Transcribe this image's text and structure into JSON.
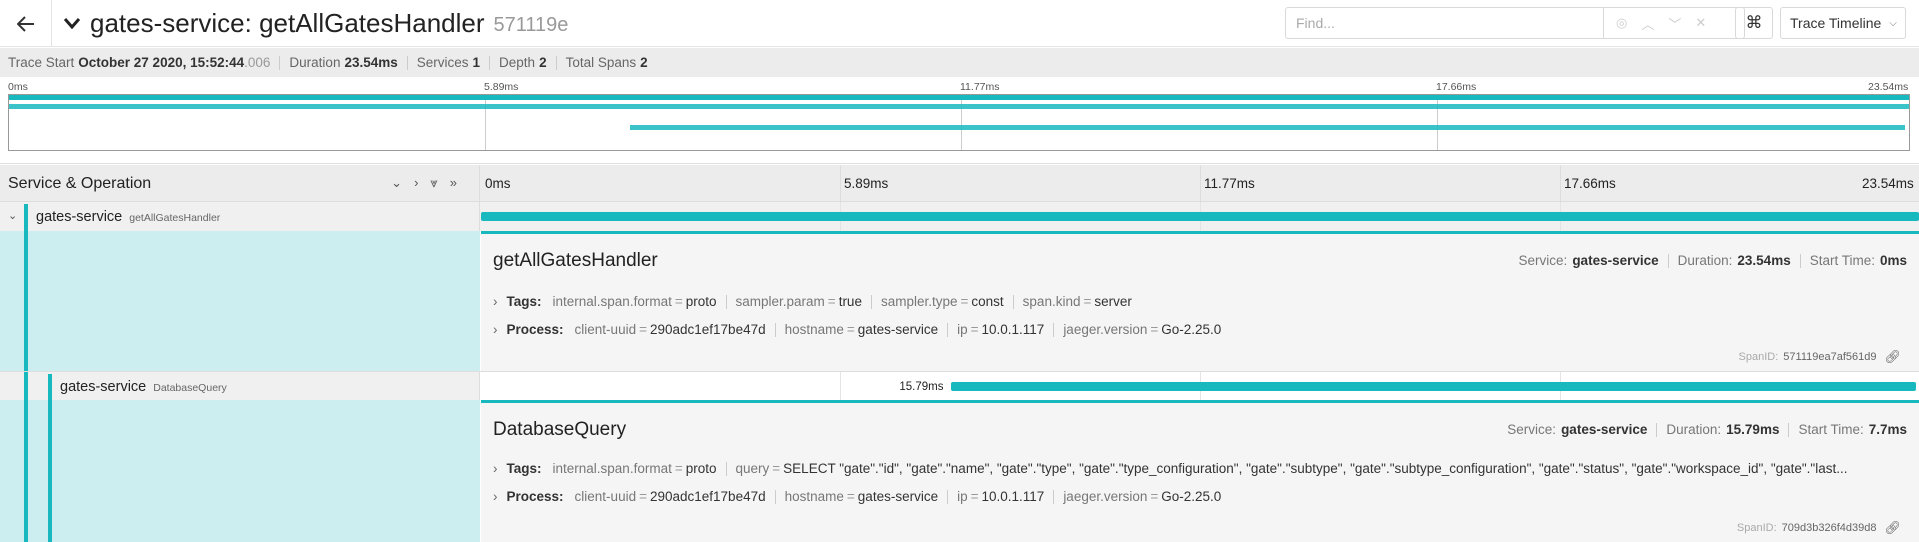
{
  "header": {
    "back_icon": "arrow-left-icon",
    "collapse_icon": "chevron-down-icon",
    "title": "gates-service: getAllGatesHandler",
    "trace_id": "571119e",
    "find_placeholder": "Find...",
    "keyboard_shortcut_label": "⌘",
    "view_mode": "Trace Timeline"
  },
  "summary": {
    "trace_start_label": "Trace Start",
    "trace_start_value": "October 27 2020, 15:52:44",
    "trace_start_ms": ".006",
    "duration_label": "Duration",
    "duration_value": "23.54ms",
    "services_label": "Services",
    "services_value": "1",
    "depth_label": "Depth",
    "depth_value": "2",
    "total_spans_label": "Total Spans",
    "total_spans_value": "2"
  },
  "minimap": {
    "ticks": [
      "0ms",
      "5.89ms",
      "11.77ms",
      "17.66ms",
      "23.54ms"
    ]
  },
  "timeline_header": {
    "title": "Service & Operation",
    "ticks": [
      "0ms",
      "5.89ms",
      "11.77ms",
      "17.66ms",
      "23.54ms"
    ]
  },
  "spans": [
    {
      "service": "gates-service",
      "operation": "getAllGatesHandler",
      "start_ms": 0,
      "duration_ms": 23.54,
      "detail": {
        "title": "getAllGatesHandler",
        "service_label": "Service:",
        "service_value": "gates-service",
        "duration_label": "Duration:",
        "duration_value": "23.54ms",
        "start_label": "Start Time:",
        "start_value": "0ms",
        "tags_label": "Tags:",
        "tags": [
          {
            "k": "internal.span.format",
            "v": "proto"
          },
          {
            "k": "sampler.param",
            "v": "true"
          },
          {
            "k": "sampler.type",
            "v": "const"
          },
          {
            "k": "span.kind",
            "v": "server"
          }
        ],
        "process_label": "Process:",
        "process": [
          {
            "k": "client-uuid",
            "v": "290adc1ef17be47d"
          },
          {
            "k": "hostname",
            "v": "gates-service"
          },
          {
            "k": "ip",
            "v": "10.0.1.117"
          },
          {
            "k": "jaeger.version",
            "v": "Go-2.25.0"
          }
        ],
        "span_id_label": "SpanID:",
        "span_id": "571119ea7af561d9"
      }
    },
    {
      "service": "gates-service",
      "operation": "DatabaseQuery",
      "start_ms": 7.7,
      "duration_ms": 15.79,
      "bar_label": "15.79ms",
      "detail": {
        "title": "DatabaseQuery",
        "service_label": "Service:",
        "service_value": "gates-service",
        "duration_label": "Duration:",
        "duration_value": "15.79ms",
        "start_label": "Start Time:",
        "start_value": "7.7ms",
        "tags_label": "Tags:",
        "tags": [
          {
            "k": "internal.span.format",
            "v": "proto"
          },
          {
            "k": "query",
            "v": "SELECT \"gate\".\"id\", \"gate\".\"name\", \"gate\".\"type\", \"gate\".\"type_configuration\", \"gate\".\"subtype\", \"gate\".\"subtype_configuration\", \"gate\".\"status\", \"gate\".\"workspace_id\", \"gate\".\"last..."
          }
        ],
        "process_label": "Process:",
        "process": [
          {
            "k": "client-uuid",
            "v": "290adc1ef17be47d"
          },
          {
            "k": "hostname",
            "v": "gates-service"
          },
          {
            "k": "ip",
            "v": "10.0.1.117"
          },
          {
            "k": "jaeger.version",
            "v": "Go-2.25.0"
          }
        ],
        "span_id_label": "SpanID:",
        "span_id": "709d3b326f4d39d8"
      }
    }
  ],
  "colors": {
    "accent": "#17b8be",
    "detail_bg": "#cdeef0"
  }
}
